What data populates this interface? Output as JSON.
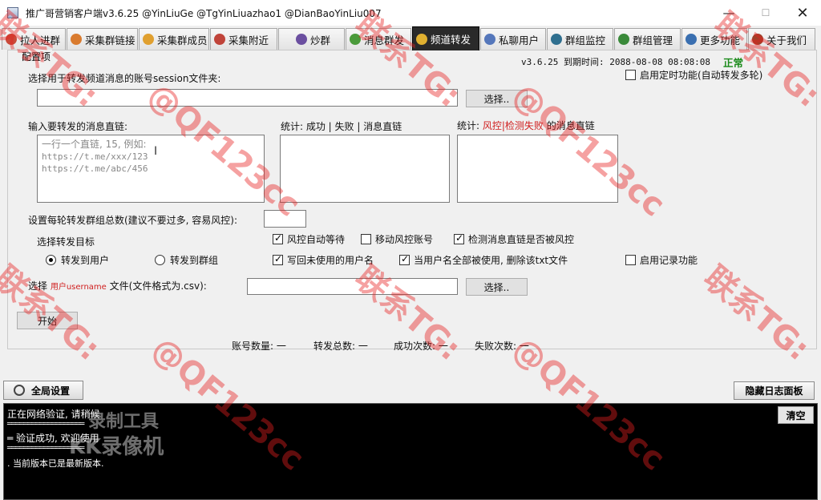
{
  "window": {
    "title": "推广哥营销客户端v3.6.25 @YinLiuGe @TgYinLiuazhao1 @DianBaoYinLiu007",
    "minimize": "—",
    "maximize": "☐",
    "close": "✕"
  },
  "tabs": [
    {
      "label": "拉人进群",
      "icon": "person-icon",
      "color": "#c94a3a"
    },
    {
      "label": "采集群链接",
      "icon": "person-icon",
      "color": "#d97b2f"
    },
    {
      "label": "采集群成员",
      "icon": "person-icon",
      "color": "#e0a030"
    },
    {
      "label": "采集附近",
      "icon": "person-icon",
      "color": "#c0443a"
    },
    {
      "label": "炒群",
      "icon": "person-icon",
      "color": "#6b4fa0"
    },
    {
      "label": "消息群发",
      "icon": "parrot-icon",
      "color": "#4a9a3a"
    },
    {
      "label": "频道转发",
      "icon": "person-icon",
      "color": "#e0b030"
    },
    {
      "label": "私聊用户",
      "icon": "person-icon",
      "color": "#5577bb"
    },
    {
      "label": "群组监控",
      "icon": "person-icon",
      "color": "#2f6f8f"
    },
    {
      "label": "群组管理",
      "icon": "check-icon",
      "color": "#3a8a3a"
    },
    {
      "label": "更多功能",
      "icon": "person-icon",
      "color": "#3a6fb0"
    },
    {
      "label": "关于我们",
      "icon": "person-icon",
      "color": "#a0402a"
    }
  ],
  "active_tab": 6,
  "config": {
    "group_label": "配置项",
    "version_expiry": "v3.6.25  到期时间: 2088-08-08 08:08:08",
    "status": "正常",
    "session_label": "选择用于转发频道消息的账号session文件夹:",
    "session_value": "",
    "select_button": "选择..",
    "timer_label": "启用定时功能(自动转发多轮)",
    "links_label": "输入要转发的消息直链:",
    "links_placeholder": [
      "一行一个直链, 15, 例如:",
      "https://t.me/xxx/123",
      "https://t.me/abc/456"
    ],
    "stats_success_label": "统计: 成功 | 失败 | 消息直链",
    "stats_risk_prefix": "统计: ",
    "stats_risk_red": "风控|检测失败",
    "stats_risk_suffix": " 的消息直链",
    "groups_per_round_label": "设置每轮转发群组总数(建议不要过多, 容易风控):",
    "groups_per_round_value": "",
    "target_label": "选择转发目标",
    "target_users": "转发到用户",
    "target_groups": "转发到群组",
    "risk_wait": "风控自动等待",
    "move_risk_account": "移动风控账号",
    "check_risk_links": "检测消息直链是否被风控",
    "write_back_unused": "写回未使用的用户名",
    "delete_when_used": "当用户名全部被使用, 删除该txt文件",
    "enable_logging": "启用记录功能",
    "select_prefix": "选择 ",
    "select_red": "用户username",
    "select_suffix": " 文件(文件格式为.csv):",
    "csv_value": "",
    "select_button2": "选择..",
    "start_button": "开始"
  },
  "stats_bar": {
    "account_count": "账号数量: 一",
    "forward_total": "转发总数: 一",
    "success_count": "成功次数: 一",
    "fail_count": "失败次数: 一"
  },
  "bottom": {
    "global_settings": "全局设置",
    "hide_log": "隐藏日志面板",
    "clear": "清空"
  },
  "log_lines": [
    "正在网络验证, 请稍候",
    "═══════════════════",
    "═    验证成功, 欢迎使用",
    "═══════════════════",
    ". 当前版本已是最新版本."
  ],
  "watermarks": {
    "contact": "联系TG:",
    "handle": "@QF123cc",
    "recorder_line1": "录制工具",
    "recorder_line2": "KK录像机"
  }
}
